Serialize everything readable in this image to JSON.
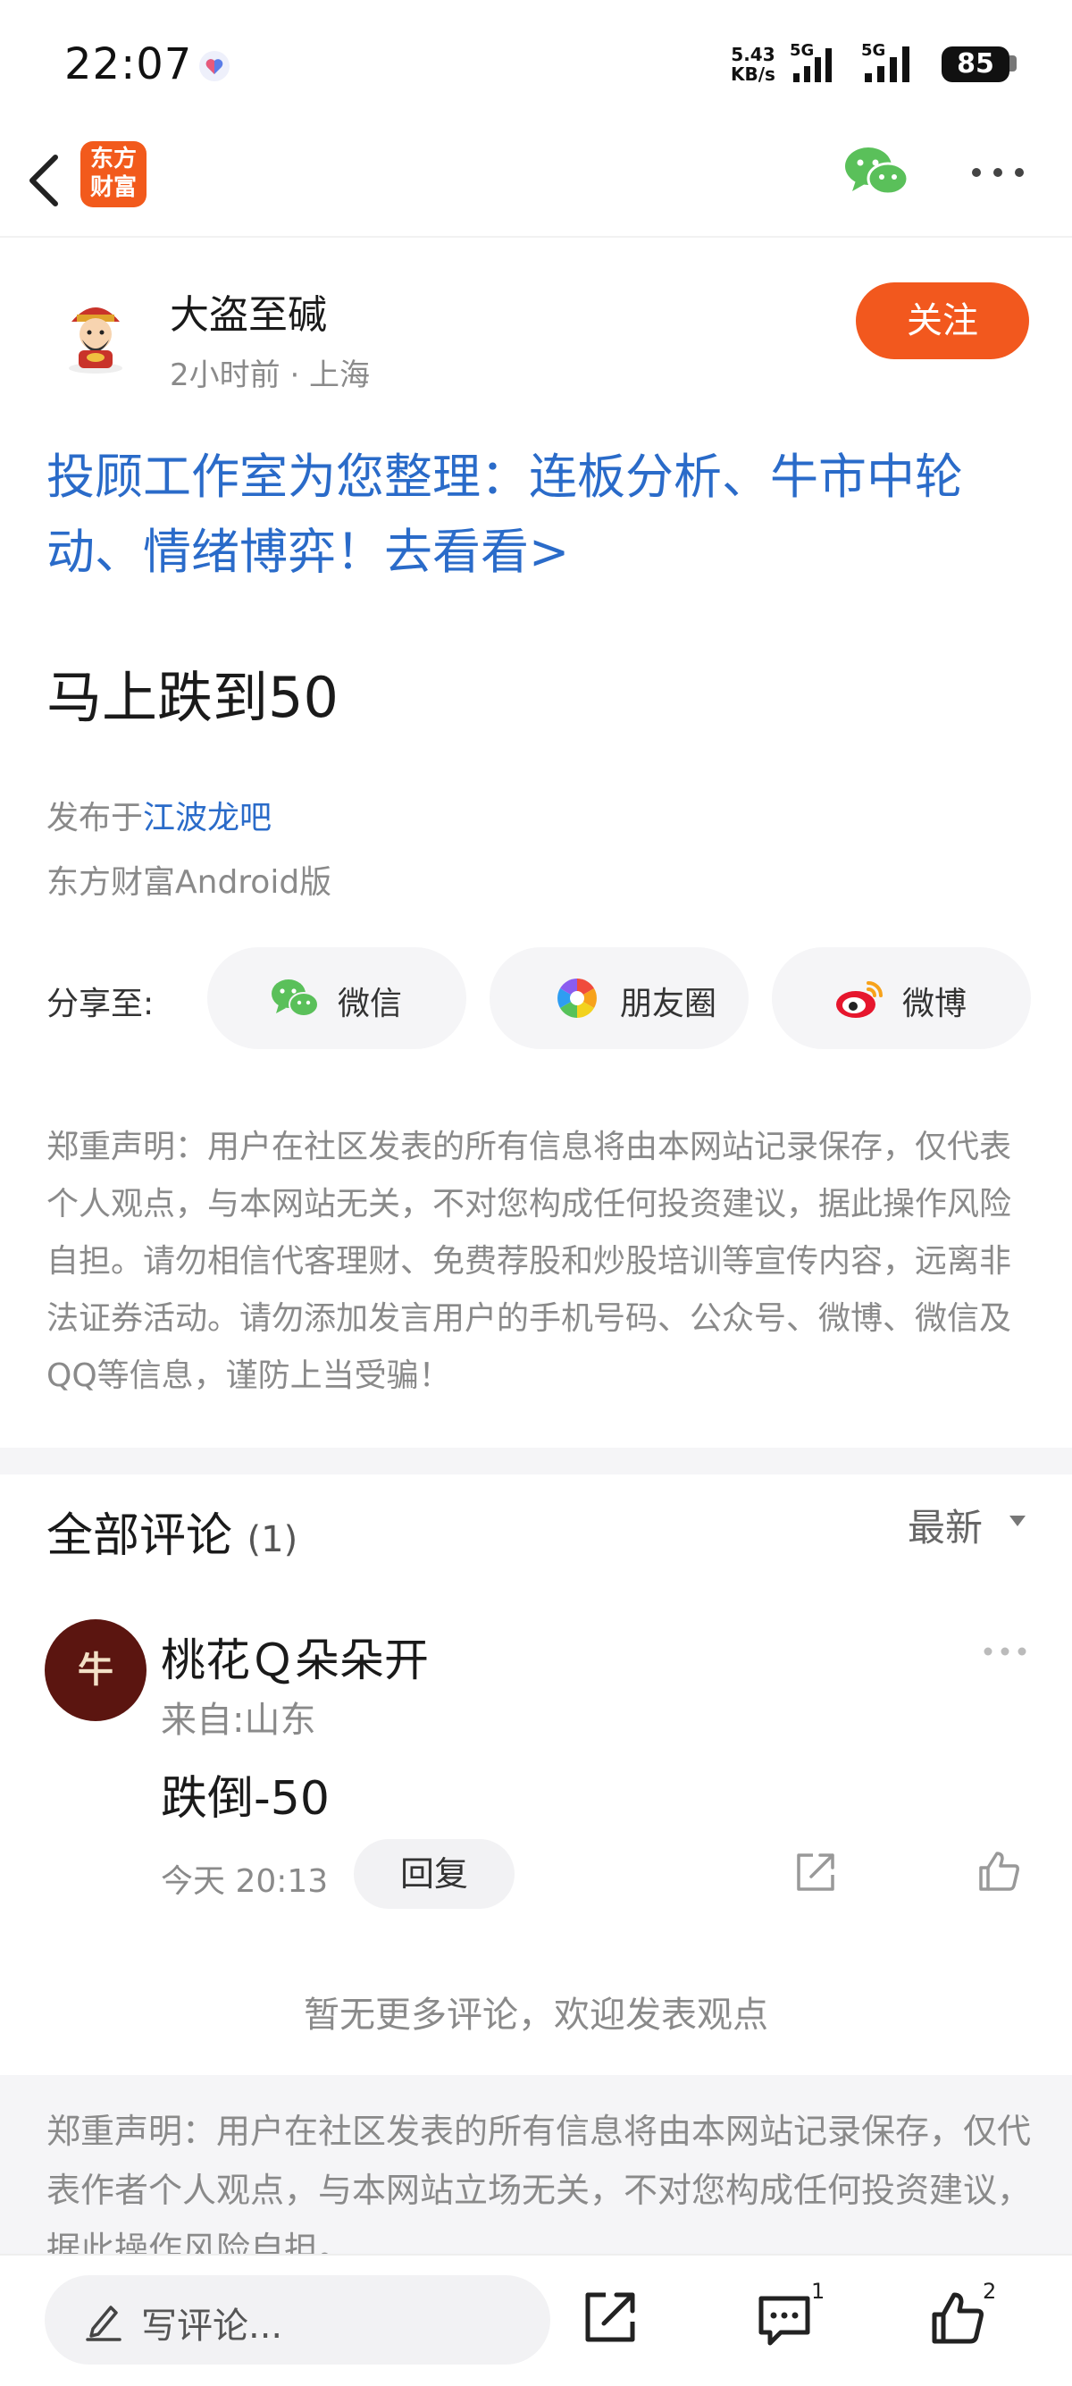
{
  "status_bar": {
    "time": "22:07",
    "net_speed_value": "5.43",
    "net_speed_unit": "KB/s",
    "signal_1_label": "5G",
    "signal_2_label": "5G",
    "battery": "85"
  },
  "nav": {
    "logo_line1": "东方",
    "logo_line2": "财富"
  },
  "post": {
    "author_name": "大盗至碱",
    "author_meta": "2小时前 · 上海",
    "follow_label": "关注",
    "promo_text": "投顾工作室为您整理：连板分析、牛市中轮动、情绪博弈！去看看>",
    "title": "马上跌到50",
    "published_prefix": "发布于",
    "bar_name": "江波龙吧",
    "client": "东方财富Android版"
  },
  "share": {
    "label": "分享至:",
    "wechat": "微信",
    "moments": "朋友圈",
    "weibo": "微博"
  },
  "disclaimer": "郑重声明：用户在社区发表的所有信息将由本网站记录保存，仅代表个人观点，与本网站无关，不对您构成任何投资建议，据此操作风险自担。请勿相信代客理财、免费荐股和炒股培训等宣传内容，远离非法证券活动。请勿添加发言用户的手机号码、公众号、微博、微信及QQ等信息，谨防上当受骗！",
  "comments": {
    "title": "全部评论",
    "count": "(1)",
    "sort_label": "最新",
    "items": [
      {
        "avatar_text": "牛",
        "user": "桃花Ｑ朵朵开",
        "location": "来自:山东",
        "text": "跌倒-50",
        "time": "今天 20:13",
        "reply_label": "回复"
      }
    ],
    "no_more": "暂无更多评论，欢迎发表观点"
  },
  "footer_disclaimer": "郑重声明：用户在社区发表的所有信息将由本网站记录保存，仅代表作者个人观点，与本网站立场无关，不对您构成任何投资建议，据此操作风险自担。",
  "bottom_bar": {
    "write_placeholder": "写评论...",
    "comment_count": "1",
    "like_count": "2"
  },
  "colors": {
    "brand_orange": "#f2581e",
    "link_blue": "#2a6bc9",
    "wechat_green": "#5ac05a",
    "weibo_red": "#e6162d"
  },
  "icons": [
    "back-icon",
    "heart-icon",
    "wechat-icon",
    "more-icon",
    "moments-icon",
    "weibo-icon",
    "share-icon",
    "like-icon",
    "comment-icon",
    "pencil-icon",
    "caret-down-icon"
  ]
}
